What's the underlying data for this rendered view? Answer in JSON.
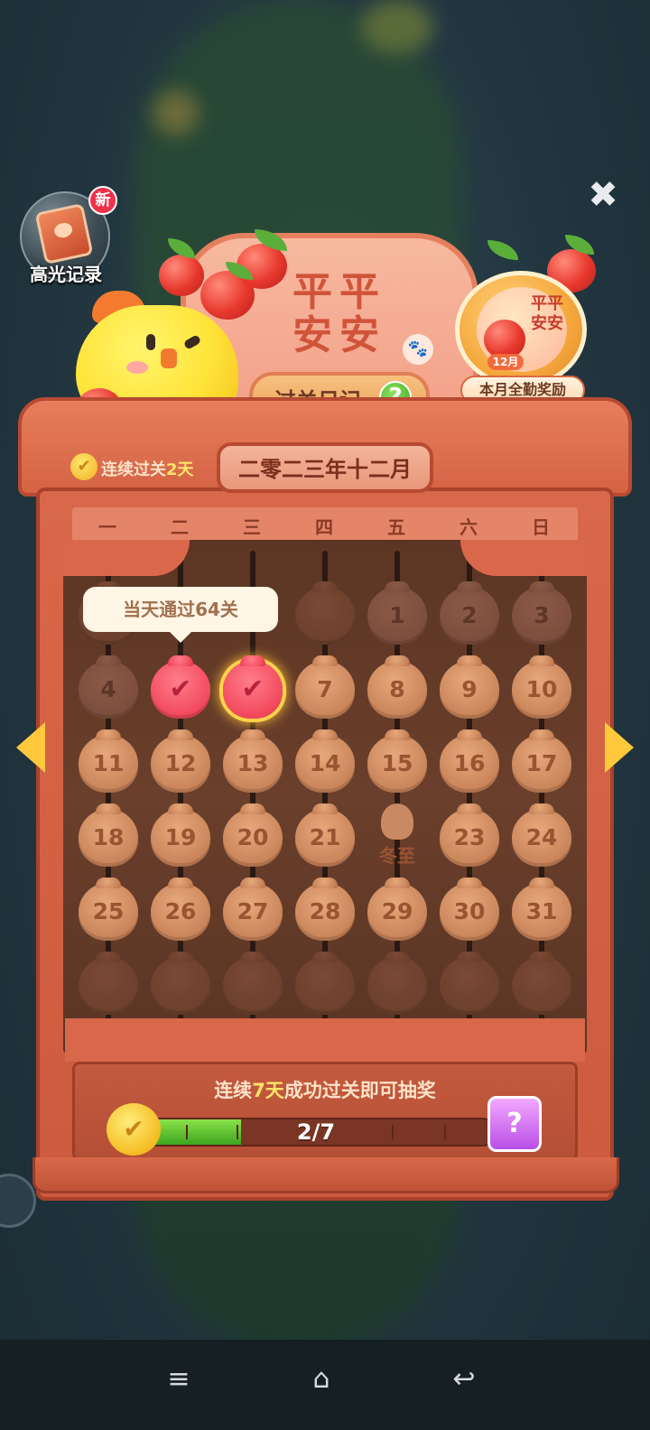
{
  "highlights": {
    "label": "高光记录",
    "badge": "新"
  },
  "header": {
    "title_lines": [
      "平平",
      "安安"
    ],
    "diary_label": "过关日记",
    "help_symbol": "?",
    "paw_symbol": "🐾"
  },
  "reward": {
    "chars": "平平安安",
    "month": "12月",
    "label": "本月全勤奖励"
  },
  "close_symbol": "✖",
  "streak": {
    "prefix": "连续过关",
    "days": "2天"
  },
  "month_label": "二零二三年十二月",
  "weekdays": [
    "一",
    "二",
    "三",
    "四",
    "五",
    "六",
    "日"
  ],
  "tooltip": "当天通过64关",
  "calendar": {
    "done_days": [
      "5",
      "6"
    ],
    "today_day": "6",
    "special": {
      "day": "22",
      "label": "冬至"
    },
    "day_labels": {
      "d1": "1",
      "d2": "2",
      "d3": "3",
      "d4": "4",
      "d7": "7",
      "d8": "8",
      "d9": "9",
      "d10": "10",
      "d11": "11",
      "d12": "12",
      "d13": "13",
      "d14": "14",
      "d15": "15",
      "d16": "16",
      "d17": "17",
      "d18": "18",
      "d19": "19",
      "d20": "20",
      "d21": "21",
      "d23": "23",
      "d24": "24",
      "d25": "25",
      "d26": "26",
      "d27": "27",
      "d28": "28",
      "d29": "29",
      "d30": "30",
      "d31": "31"
    },
    "check_symbol": "✔"
  },
  "lottery": {
    "prefix": "连续",
    "highlight": "7天",
    "suffix": "成功过关即可抽奖"
  },
  "progress": {
    "text": "2/7",
    "current": 2,
    "total": 7
  },
  "gift_symbol": "?",
  "coin_symbol": "✔",
  "nav": {
    "menu": "≡",
    "home": "⌂",
    "back": "↩"
  },
  "colors": {
    "accent": "#e77e5c",
    "done": "#f2495c",
    "progress": "#3da41f",
    "gold": "#ffc93b"
  }
}
